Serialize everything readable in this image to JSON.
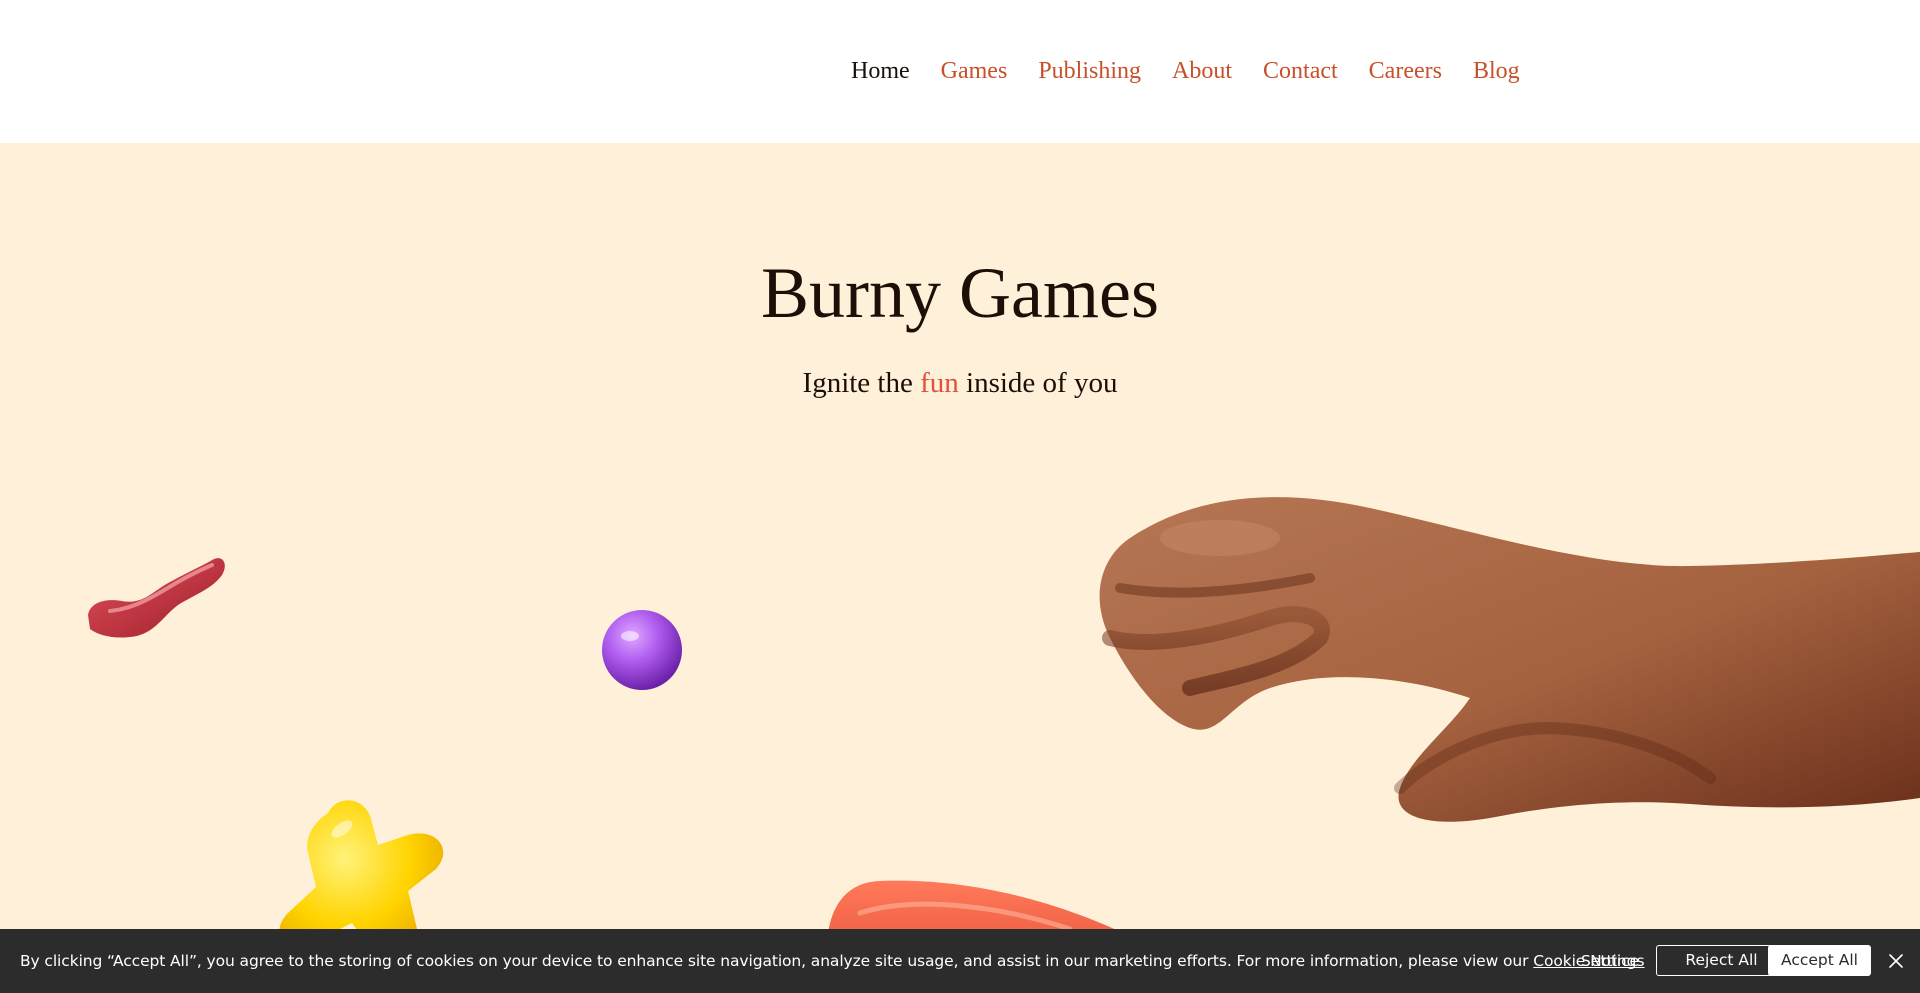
{
  "nav": {
    "items": [
      {
        "label": "Home",
        "active": true
      },
      {
        "label": "Games",
        "active": false
      },
      {
        "label": "Publishing",
        "active": false
      },
      {
        "label": "About",
        "active": false
      },
      {
        "label": "Contact",
        "active": false
      },
      {
        "label": "Careers",
        "active": false
      },
      {
        "label": "Blog",
        "active": false
      }
    ]
  },
  "hero": {
    "title": "Burny Games",
    "tagline_before": "Ignite the ",
    "tagline_accent": "fun",
    "tagline_after": " inside of you",
    "decorations": [
      "red-wavy-candy",
      "purple-ball",
      "yellow-cross-candy",
      "cartoon-hand",
      "red-orange-candy"
    ]
  },
  "cookie": {
    "text_before": "By clicking “Accept All”, you agree to the storing of cookies on your device to enhance site navigation, analyze site usage, and assist in our marketing efforts. For more information, please view our ",
    "notice_link": "Cookie Notice",
    "settings_label": "Settings",
    "reject_label": "Reject All",
    "accept_label": "Accept All",
    "close_icon": "close-icon"
  },
  "colors": {
    "nav_link": "#c8502a",
    "nav_active": "#1a0f0c",
    "hero_bg": "#fff0d9",
    "accent": "#e0503a",
    "cookie_bg": "#2c2c2c"
  }
}
